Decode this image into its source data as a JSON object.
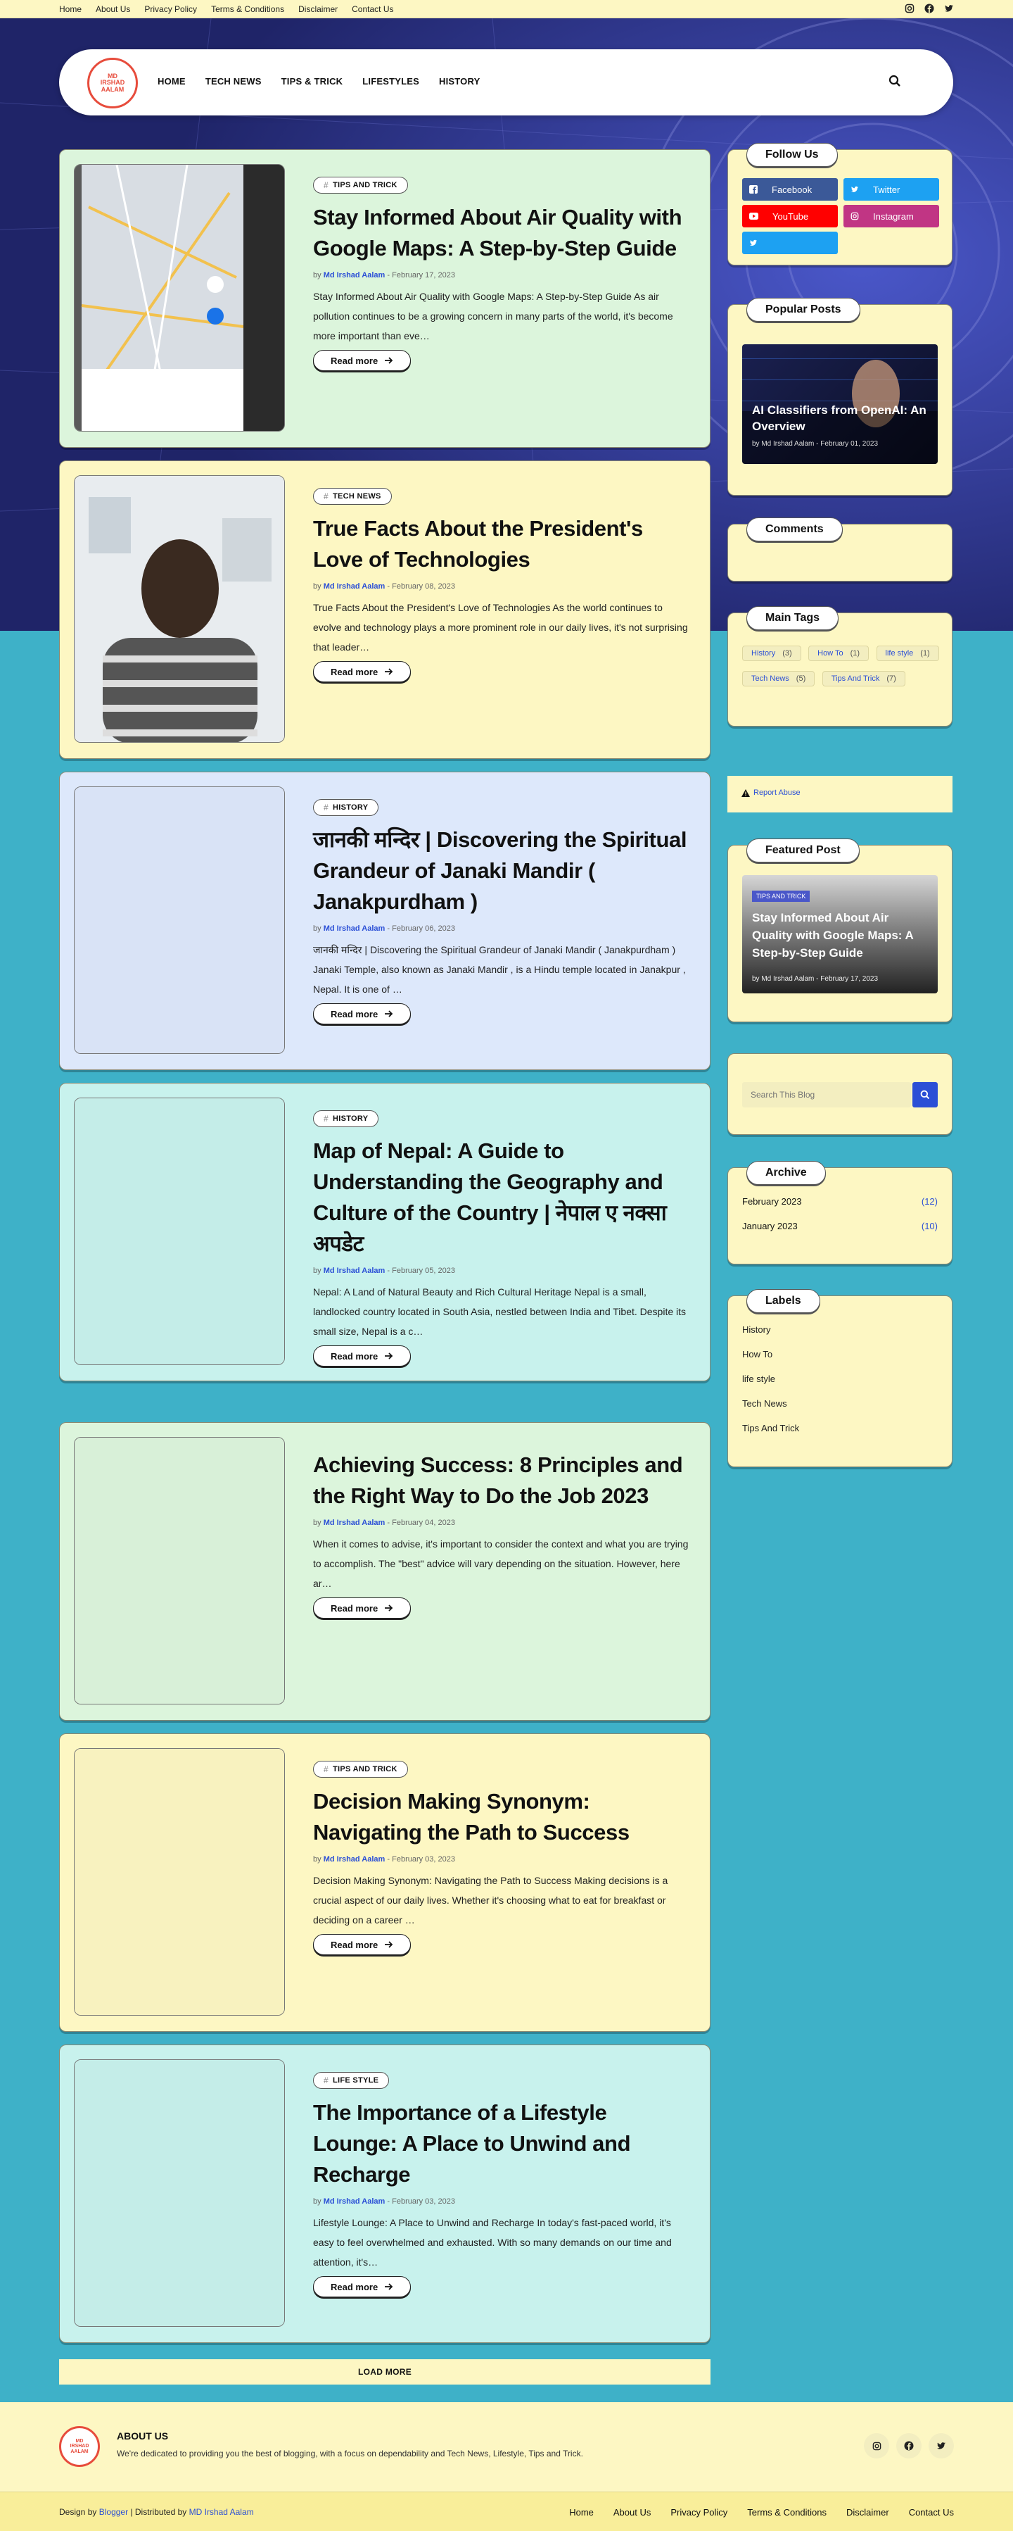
{
  "topbar": {
    "links": [
      "Home",
      "About Us",
      "Privacy Policy",
      "Terms & Conditions",
      "Disclaimer",
      "Contact Us"
    ],
    "icons": [
      "instagram-icon",
      "facebook-icon",
      "twitter-icon"
    ]
  },
  "nav": {
    "logo_text": "MD IRSHAD AALAM",
    "menu": [
      "HOME",
      "TECH NEWS",
      "TIPS & TRICK",
      "LIFESTYLES",
      "HISTORY"
    ]
  },
  "posts": [
    {
      "tag": "TIPS AND TRICK",
      "title": "Stay Informed About Air Quality with Google Maps: A Step-by-Step Guide",
      "author": "Md Irshad Aalam",
      "date": "February 17, 2023",
      "excerpt": "Stay Informed About Air Quality with Google Maps: A Step-by-Step Guide As air pollution continues to be a growing concern in many parts of the world, it's become more important than eve…",
      "read_more": "Read more",
      "bg": "#dcf5dc"
    },
    {
      "tag": "TECH NEWS",
      "title": "True Facts About the President's Love of Technologies",
      "author": "Md Irshad Aalam",
      "date": "February 08, 2023",
      "excerpt": "True Facts About the President's Love of Technologies As the world continues to evolve and technology plays a more prominent role in our daily lives, it's not surprising that leader…",
      "read_more": "Read more",
      "bg": "#fdf7c3"
    },
    {
      "tag": "HISTORY",
      "title": "जानकी मन्दिर | Discovering the Spiritual Grandeur of Janaki Mandir ( Janakpurdham )",
      "author": "Md Irshad Aalam",
      "date": "February 06, 2023",
      "excerpt": "जानकी मन्दिर | Discovering the Spiritual Grandeur of Janaki Mandir ( Janakpurdham ) Janaki Temple, also known as Janaki Mandir , is a Hindu temple located in Janakpur , Nepal. It is one of …",
      "read_more": "Read more",
      "bg": "#dde8fb"
    },
    {
      "tag": "HISTORY",
      "title": "Map of Nepal: A Guide to Understanding the Geography and Culture of the Country | नेपाल ए नक्सा अपडेट",
      "author": "Md Irshad Aalam",
      "date": "February 05, 2023",
      "excerpt": "Nepal: A Land of Natural Beauty and Rich Cultural Heritage Nepal is a small, landlocked country located in South Asia, nestled between India and Tibet. Despite its small size, Nepal is a c…",
      "read_more": "Read more",
      "bg": "#c8f2ed"
    },
    {
      "tag": "",
      "title": "Achieving Success: 8 Principles and the Right Way to Do the Job 2023",
      "author": "Md Irshad Aalam",
      "date": "February 04, 2023",
      "excerpt": "When it comes to advise, it's important to consider the context and what you are trying to accomplish. The \"best\" advice will vary depending on the situation. However, here ar…",
      "read_more": "Read more",
      "bg": "#dcf5dc"
    },
    {
      "tag": "TIPS AND TRICK",
      "title": "Decision Making Synonym: Navigating the Path to Success",
      "author": "Md Irshad Aalam",
      "date": "February 03, 2023",
      "excerpt": "Decision Making Synonym: Navigating the Path to Success Making decisions is a crucial aspect of our daily lives. Whether it's choosing what to eat for breakfast or deciding on a career …",
      "read_more": "Read more",
      "bg": "#fdf7c3"
    },
    {
      "tag": "LIFE STYLE",
      "title": "The Importance of a Lifestyle Lounge: A Place to Unwind and Recharge",
      "author": "Md Irshad Aalam",
      "date": "February 03, 2023",
      "excerpt": "Lifestyle Lounge: A Place to Unwind and Recharge In today's fast-paced world, it's easy to feel overwhelmed and exhausted. With so many demands on our time and attention, it's…",
      "read_more": "Read more",
      "bg": "#c8f2ed"
    }
  ],
  "meta_by": "by",
  "meta_sep": "-",
  "load_more": "LOAD MORE",
  "sidebar": {
    "follow_title": "Follow Us",
    "social": [
      {
        "label": "Facebook",
        "color": "#3b5998"
      },
      {
        "label": "Twitter",
        "color": "#1da1f2"
      },
      {
        "label": "YouTube",
        "color": "#ff0000"
      },
      {
        "label": "Instagram",
        "color": "#c13584"
      },
      {
        "label": "",
        "color": "#1da1f2"
      }
    ],
    "popular_title": "Popular Posts",
    "popular": {
      "title": "AI Classifiers from OpenAI: An Overview",
      "author": "Md Irshad Aalam",
      "date": "February 01, 2023"
    },
    "comments_title": "Comments",
    "tags_title": "Main Tags",
    "tags": [
      {
        "name": "History",
        "count": "(3)"
      },
      {
        "name": "How To",
        "count": "(1)"
      },
      {
        "name": "life style",
        "count": "(1)"
      },
      {
        "name": "Tech News",
        "count": "(5)"
      },
      {
        "name": "Tips And Trick",
        "count": "(7)"
      }
    ],
    "report": "Report Abuse",
    "featured_title": "Featured Post",
    "featured": {
      "tag": "TIPS AND TRICK",
      "title": "Stay Informed About Air Quality with Google Maps: A Step-by-Step Guide",
      "author": "Md Irshad Aalam",
      "date": "February 17, 2023"
    },
    "search_placeholder": "Search This Blog",
    "archive_title": "Archive",
    "archive": [
      {
        "label": "February 2023",
        "count": "(12)"
      },
      {
        "label": "January 2023",
        "count": "(10)"
      }
    ],
    "labels_title": "Labels",
    "labels": [
      "History",
      "How To",
      "life style",
      "Tech News",
      "Tips And Trick"
    ]
  },
  "footer": {
    "about_title": "ABOUT US",
    "about_text": "We're dedicated to providing you the best of blogging, with a focus on dependability and Tech News, Lifestyle, Tips and Trick.",
    "design_prefix": "Design by",
    "design_by": "Blogger",
    "dist_prefix": "| Distributed by",
    "dist_by": "MD Irshad Aalam",
    "links": [
      "Home",
      "About Us",
      "Privacy Policy",
      "Terms & Conditions",
      "Disclaimer",
      "Contact Us"
    ]
  }
}
